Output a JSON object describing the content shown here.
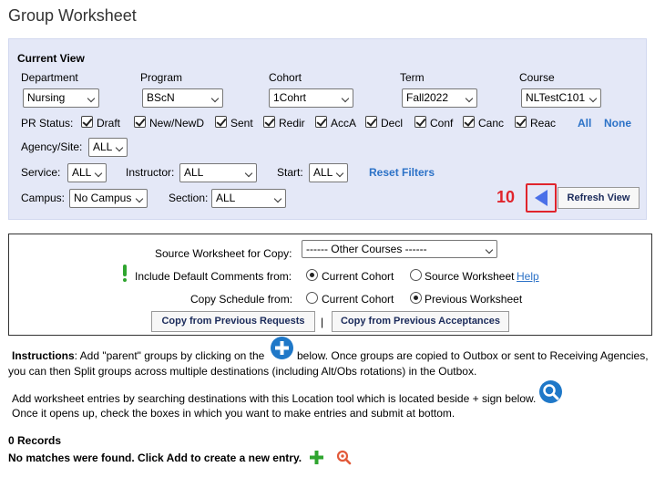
{
  "page_title": "Group Worksheet",
  "current_view": {
    "heading": "Current View",
    "department": {
      "label": "Department",
      "value": "Nursing"
    },
    "program": {
      "label": "Program",
      "value": "BScN"
    },
    "cohort": {
      "label": "Cohort",
      "value": "1Cohrt"
    },
    "term": {
      "label": "Term",
      "value": "Fall2022"
    },
    "course": {
      "label": "Course",
      "value": "NLTestC101"
    },
    "pr_status": {
      "label": "PR Status:",
      "options": [
        "Draft",
        "New/NewD",
        "Sent",
        "Redir",
        "AccA",
        "Decl",
        "Conf",
        "Canc",
        "Reac"
      ],
      "all_link": "All",
      "none_link": "None"
    },
    "agency_site": {
      "label": "Agency/Site:",
      "value": "ALL"
    },
    "service": {
      "label": "Service:",
      "value": "ALL"
    },
    "instructor": {
      "label": "Instructor:",
      "value": "ALL"
    },
    "start": {
      "label": "Start:",
      "value": "ALL"
    },
    "reset_filters": "Reset Filters",
    "campus": {
      "label": "Campus:",
      "value": "No Campus"
    },
    "section": {
      "label": "Section:",
      "value": "ALL"
    },
    "step_number": "10",
    "refresh_view": "Refresh View"
  },
  "copy_panel": {
    "source_label": "Source Worksheet for Copy:",
    "source_value": "------ Other Courses ------",
    "include_label": "Include Default Comments from:",
    "include_options": [
      "Current Cohort",
      "Source Worksheet"
    ],
    "help_link": "Help",
    "schedule_label": "Copy Schedule from:",
    "schedule_options": [
      "Current Cohort",
      "Previous Worksheet"
    ],
    "btn_requests": "Copy from Previous Requests",
    "separator": "|",
    "btn_acceptances": "Copy from Previous Acceptances"
  },
  "instructions": {
    "title": "Instructions",
    "line1a": ":  Add \"parent\" groups by clicking on the",
    "line1b": "below. Once groups are copied to Outbox or sent to Receiving Agencies,",
    "line2": "you can then Split groups across multiple destinations (including Alt/Obs rotations) in the Outbox.",
    "line3": "Add worksheet entries by searching destinations with this Location tool which is located beside + sign below.",
    "line4": "Once it opens up, check the boxes in which you want to make entries and submit at bottom."
  },
  "records": {
    "count": "0 Records",
    "empty_message": "No matches were found. Click Add to create a new entry."
  },
  "colors": {
    "panel_bg": "#e4e8f7",
    "link": "#2c72c7",
    "accent_red": "#e0242c",
    "arrow_blue": "#4a6fe8"
  }
}
